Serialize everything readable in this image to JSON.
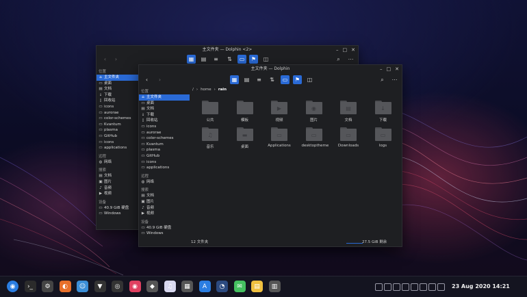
{
  "colors": {
    "accent": "#2a6ad6",
    "window_bg": "#1e1f22",
    "folder": "#55565a"
  },
  "back_window": {
    "title": "主文件夹 — Dolphin <2>",
    "sidebar": {
      "places_label": "位置",
      "places": [
        {
          "label": "主文件夹",
          "icon": "home-icon"
        },
        {
          "label": "桌面",
          "icon": "desktop-icon"
        },
        {
          "label": "文档",
          "icon": "documents-icon"
        },
        {
          "label": "下载",
          "icon": "download-icon"
        },
        {
          "label": "回收站",
          "icon": "trash-icon"
        },
        {
          "label": "icons",
          "icon": "folder-icon"
        },
        {
          "label": "aurorae",
          "icon": "folder-icon"
        },
        {
          "label": "color-schemes",
          "icon": "folder-icon"
        },
        {
          "label": "Kvantum",
          "icon": "folder-icon"
        },
        {
          "label": "plasma",
          "icon": "folder-icon"
        },
        {
          "label": "GitHub",
          "icon": "folder-icon"
        },
        {
          "label": "icons",
          "icon": "folder-icon"
        },
        {
          "label": "applications",
          "icon": "folder-icon"
        }
      ],
      "remote_label": "远程",
      "remote": [
        {
          "label": "网络",
          "icon": "network-icon"
        }
      ],
      "search_label": "搜索",
      "search": [
        {
          "label": "文档",
          "icon": "documents-icon"
        },
        {
          "label": "图片",
          "icon": "pictures-icon"
        },
        {
          "label": "音频",
          "icon": "music-icon"
        },
        {
          "label": "视频",
          "icon": "video-icon"
        }
      ],
      "devices_label": "设备",
      "devices": [
        {
          "label": "40.9 GiB 硬盘",
          "icon": "drive-icon"
        },
        {
          "label": "Windows",
          "icon": "drive-icon"
        }
      ]
    }
  },
  "front_window": {
    "title": "主文件夹 — Dolphin",
    "breadcrumb": {
      "root": "/",
      "home": "home",
      "current": "rain"
    },
    "sidebar": {
      "places_label": "位置",
      "places": [
        {
          "label": "主文件夹",
          "icon": "home-icon"
        },
        {
          "label": "桌面",
          "icon": "desktop-icon"
        },
        {
          "label": "文档",
          "icon": "documents-icon"
        },
        {
          "label": "下载",
          "icon": "download-icon"
        },
        {
          "label": "回收站",
          "icon": "trash-icon"
        },
        {
          "label": "icons",
          "icon": "folder-icon"
        },
        {
          "label": "aurorae",
          "icon": "folder-icon"
        },
        {
          "label": "color-schemes",
          "icon": "folder-icon"
        },
        {
          "label": "Kvantum",
          "icon": "folder-icon"
        },
        {
          "label": "plasma",
          "icon": "folder-icon"
        },
        {
          "label": "GitHub",
          "icon": "folder-icon"
        },
        {
          "label": "icons",
          "icon": "folder-icon"
        },
        {
          "label": "applications",
          "icon": "folder-icon"
        }
      ],
      "remote_label": "远程",
      "remote": [
        {
          "label": "网络",
          "icon": "network-icon"
        }
      ],
      "search_label": "搜索",
      "search": [
        {
          "label": "文档",
          "icon": "documents-icon"
        },
        {
          "label": "图片",
          "icon": "pictures-icon"
        },
        {
          "label": "音频",
          "icon": "music-icon"
        },
        {
          "label": "视频",
          "icon": "video-icon"
        }
      ],
      "devices_label": "设备",
      "devices": [
        {
          "label": "40.9 GiB 硬盘",
          "icon": "drive-icon"
        },
        {
          "label": "Windows",
          "icon": "drive-icon"
        }
      ]
    },
    "files": [
      {
        "name": "公共",
        "icon": "public-folder-icon"
      },
      {
        "name": "模板",
        "icon": "templates-folder-icon"
      },
      {
        "name": "视频",
        "icon": "videos-folder-icon"
      },
      {
        "name": "图片",
        "icon": "pictures-folder-icon"
      },
      {
        "name": "文档",
        "icon": "documents-folder-icon"
      },
      {
        "name": "下载",
        "icon": "downloads-folder-icon"
      },
      {
        "name": "音乐",
        "icon": "music-folder-icon"
      },
      {
        "name": "桌面",
        "icon": "desktop-folder-icon"
      },
      {
        "name": "Applications",
        "icon": "folder-icon"
      },
      {
        "name": "desktoptheme",
        "icon": "folder-icon"
      },
      {
        "name": "Downloads",
        "icon": "folder-icon"
      },
      {
        "name": "logs",
        "icon": "folder-icon"
      }
    ],
    "status": {
      "count": "12 文件夹",
      "free": "27.5 GiB 剩余"
    }
  },
  "taskbar": {
    "apps": [
      "launcher-icon",
      "terminal-icon",
      "settings-icon",
      "firefox-icon",
      "dolphin-icon",
      "inkscape-icon",
      "music-app-icon",
      "netease-music-icon",
      "github-icon",
      "itunes-icon",
      "calculator-icon",
      "appstore-icon",
      "steam-icon",
      "messages-icon",
      "notes-icon",
      "monitor-icon"
    ],
    "clock": "23 Aug 2020 14:21"
  }
}
